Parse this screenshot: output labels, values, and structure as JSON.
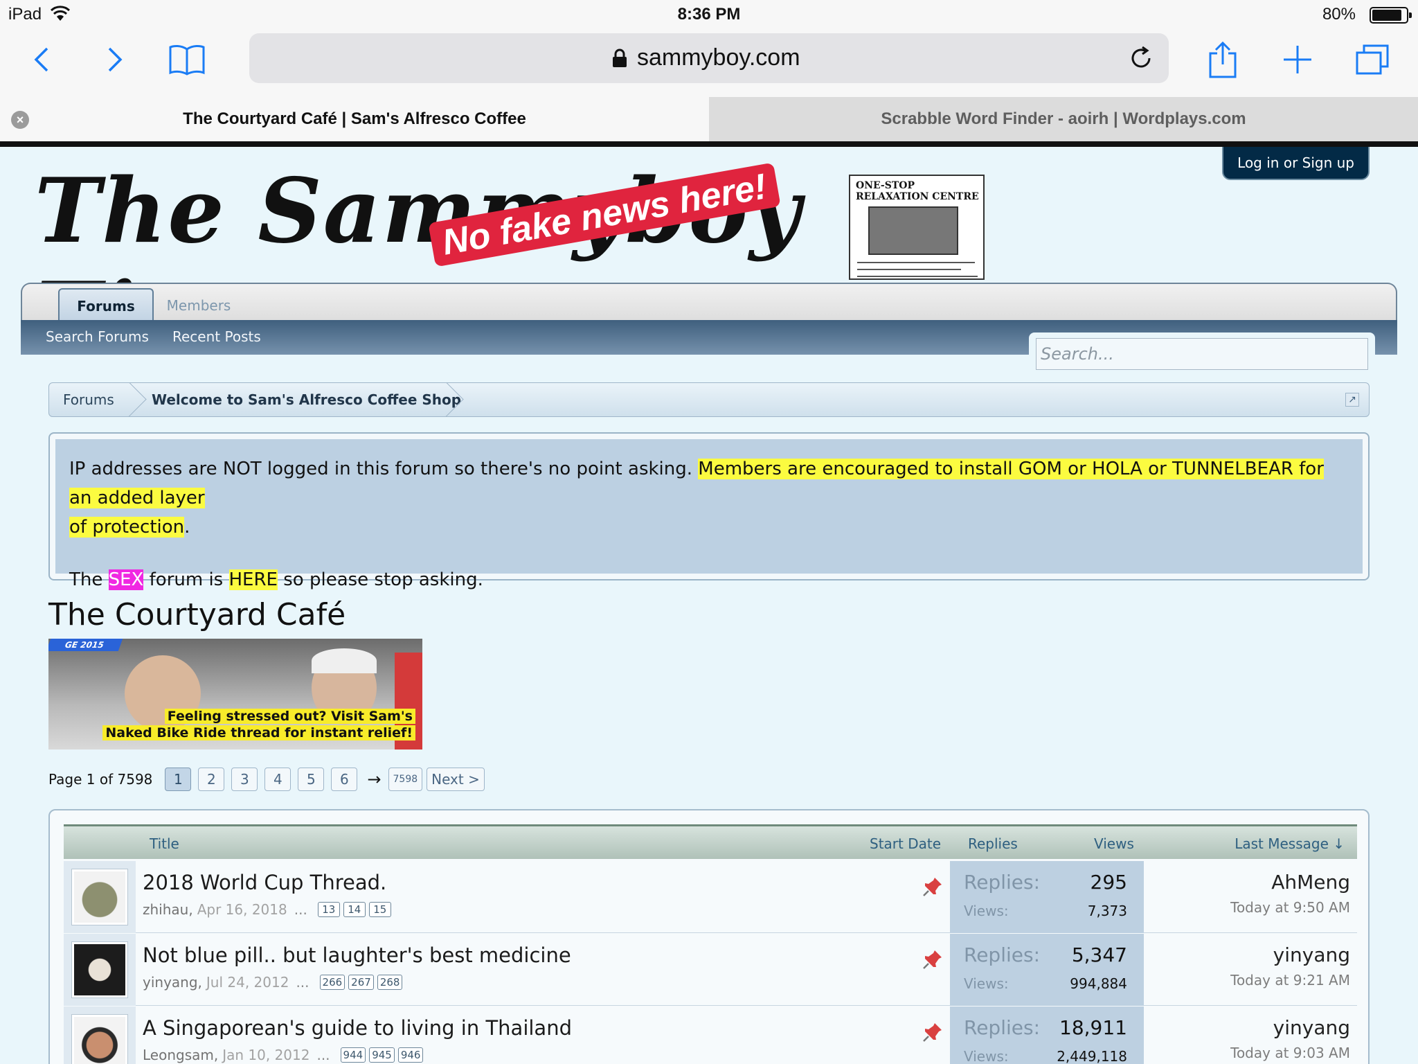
{
  "status": {
    "device": "iPad",
    "time": "8:36 PM",
    "battery": "80%",
    "battery_level": 0.8
  },
  "browser": {
    "url": "sammyboy.com",
    "tabs": [
      {
        "label": "The Courtyard Café | Sam's Alfresco Coffee",
        "active": true
      },
      {
        "label": "Scrabble Word Finder - aoirh | Wordplays.com",
        "active": false
      }
    ]
  },
  "site": {
    "logo_text": "The Sammyboy Times",
    "logo_stamp": "No fake news here!",
    "ad_text": "ONE-STOP RELAXATION CENTRE",
    "login_label": "Log in or Sign up"
  },
  "nav": {
    "tabs": [
      {
        "label": "Forums"
      },
      {
        "label": "Members"
      }
    ],
    "sub": [
      {
        "label": "Search Forums"
      },
      {
        "label": "Recent Posts"
      }
    ],
    "search_placeholder": "Search..."
  },
  "breadcrumb": [
    {
      "label": "Forums"
    },
    {
      "label": "Welcome to Sam's Alfresco Coffee Shop"
    }
  ],
  "notice": {
    "line1_plain": "IP addresses are NOT logged in this forum so there's no point asking. ",
    "line1_hl_a": "Members are encouraged to install GOM or HOLA or TUNNELBEAR for an added layer",
    "line1_hl_b": "of protection",
    "line1_end": ".",
    "line2_a": "The ",
    "line2_sex": "SEX",
    "line2_b": " forum is ",
    "line2_here": "HERE",
    "line2_c": " so please stop asking."
  },
  "forum": {
    "title": "The Courtyard Café",
    "banner": {
      "tag": "GE 2015",
      "caption_1": "Feeling stressed out? Visit Sam's",
      "caption_2": "Naked Bike Ride thread for instant relief!"
    }
  },
  "pager": {
    "label": "Page 1 of 7598",
    "pages": [
      "1",
      "2",
      "3",
      "4",
      "5",
      "6"
    ],
    "arrow": "→",
    "last": "7598",
    "next": "Next >"
  },
  "table": {
    "headers": {
      "title": "Title",
      "start_date": "Start Date",
      "replies": "Replies",
      "views": "Views",
      "last_message": "Last Message ↓"
    },
    "replies_label": "Replies:",
    "views_label": "Views:",
    "threads": [
      {
        "title": "2018 World Cup Thread.",
        "author": "zhihau,",
        "date": "Apr 16, 2018",
        "pages": [
          "13",
          "14",
          "15"
        ],
        "replies": "295",
        "views": "7,373",
        "last_user": "AhMeng",
        "last_time": "Today at 9:50 AM"
      },
      {
        "title": "Not blue pill.. but laughter's best medicine",
        "author": "yinyang,",
        "date": "Jul 24, 2012",
        "pages": [
          "266",
          "267",
          "268"
        ],
        "replies": "5,347",
        "views": "994,884",
        "last_user": "yinyang",
        "last_time": "Today at 9:21 AM"
      },
      {
        "title": "A Singaporean's guide to living in Thailand",
        "author": "Leongsam,",
        "date": "Jan 10, 2012",
        "pages": [
          "944",
          "945",
          "946"
        ],
        "replies": "18,911",
        "views": "2,449,118",
        "last_user": "yinyang",
        "last_time": "Today at 9:03 AM"
      }
    ]
  }
}
